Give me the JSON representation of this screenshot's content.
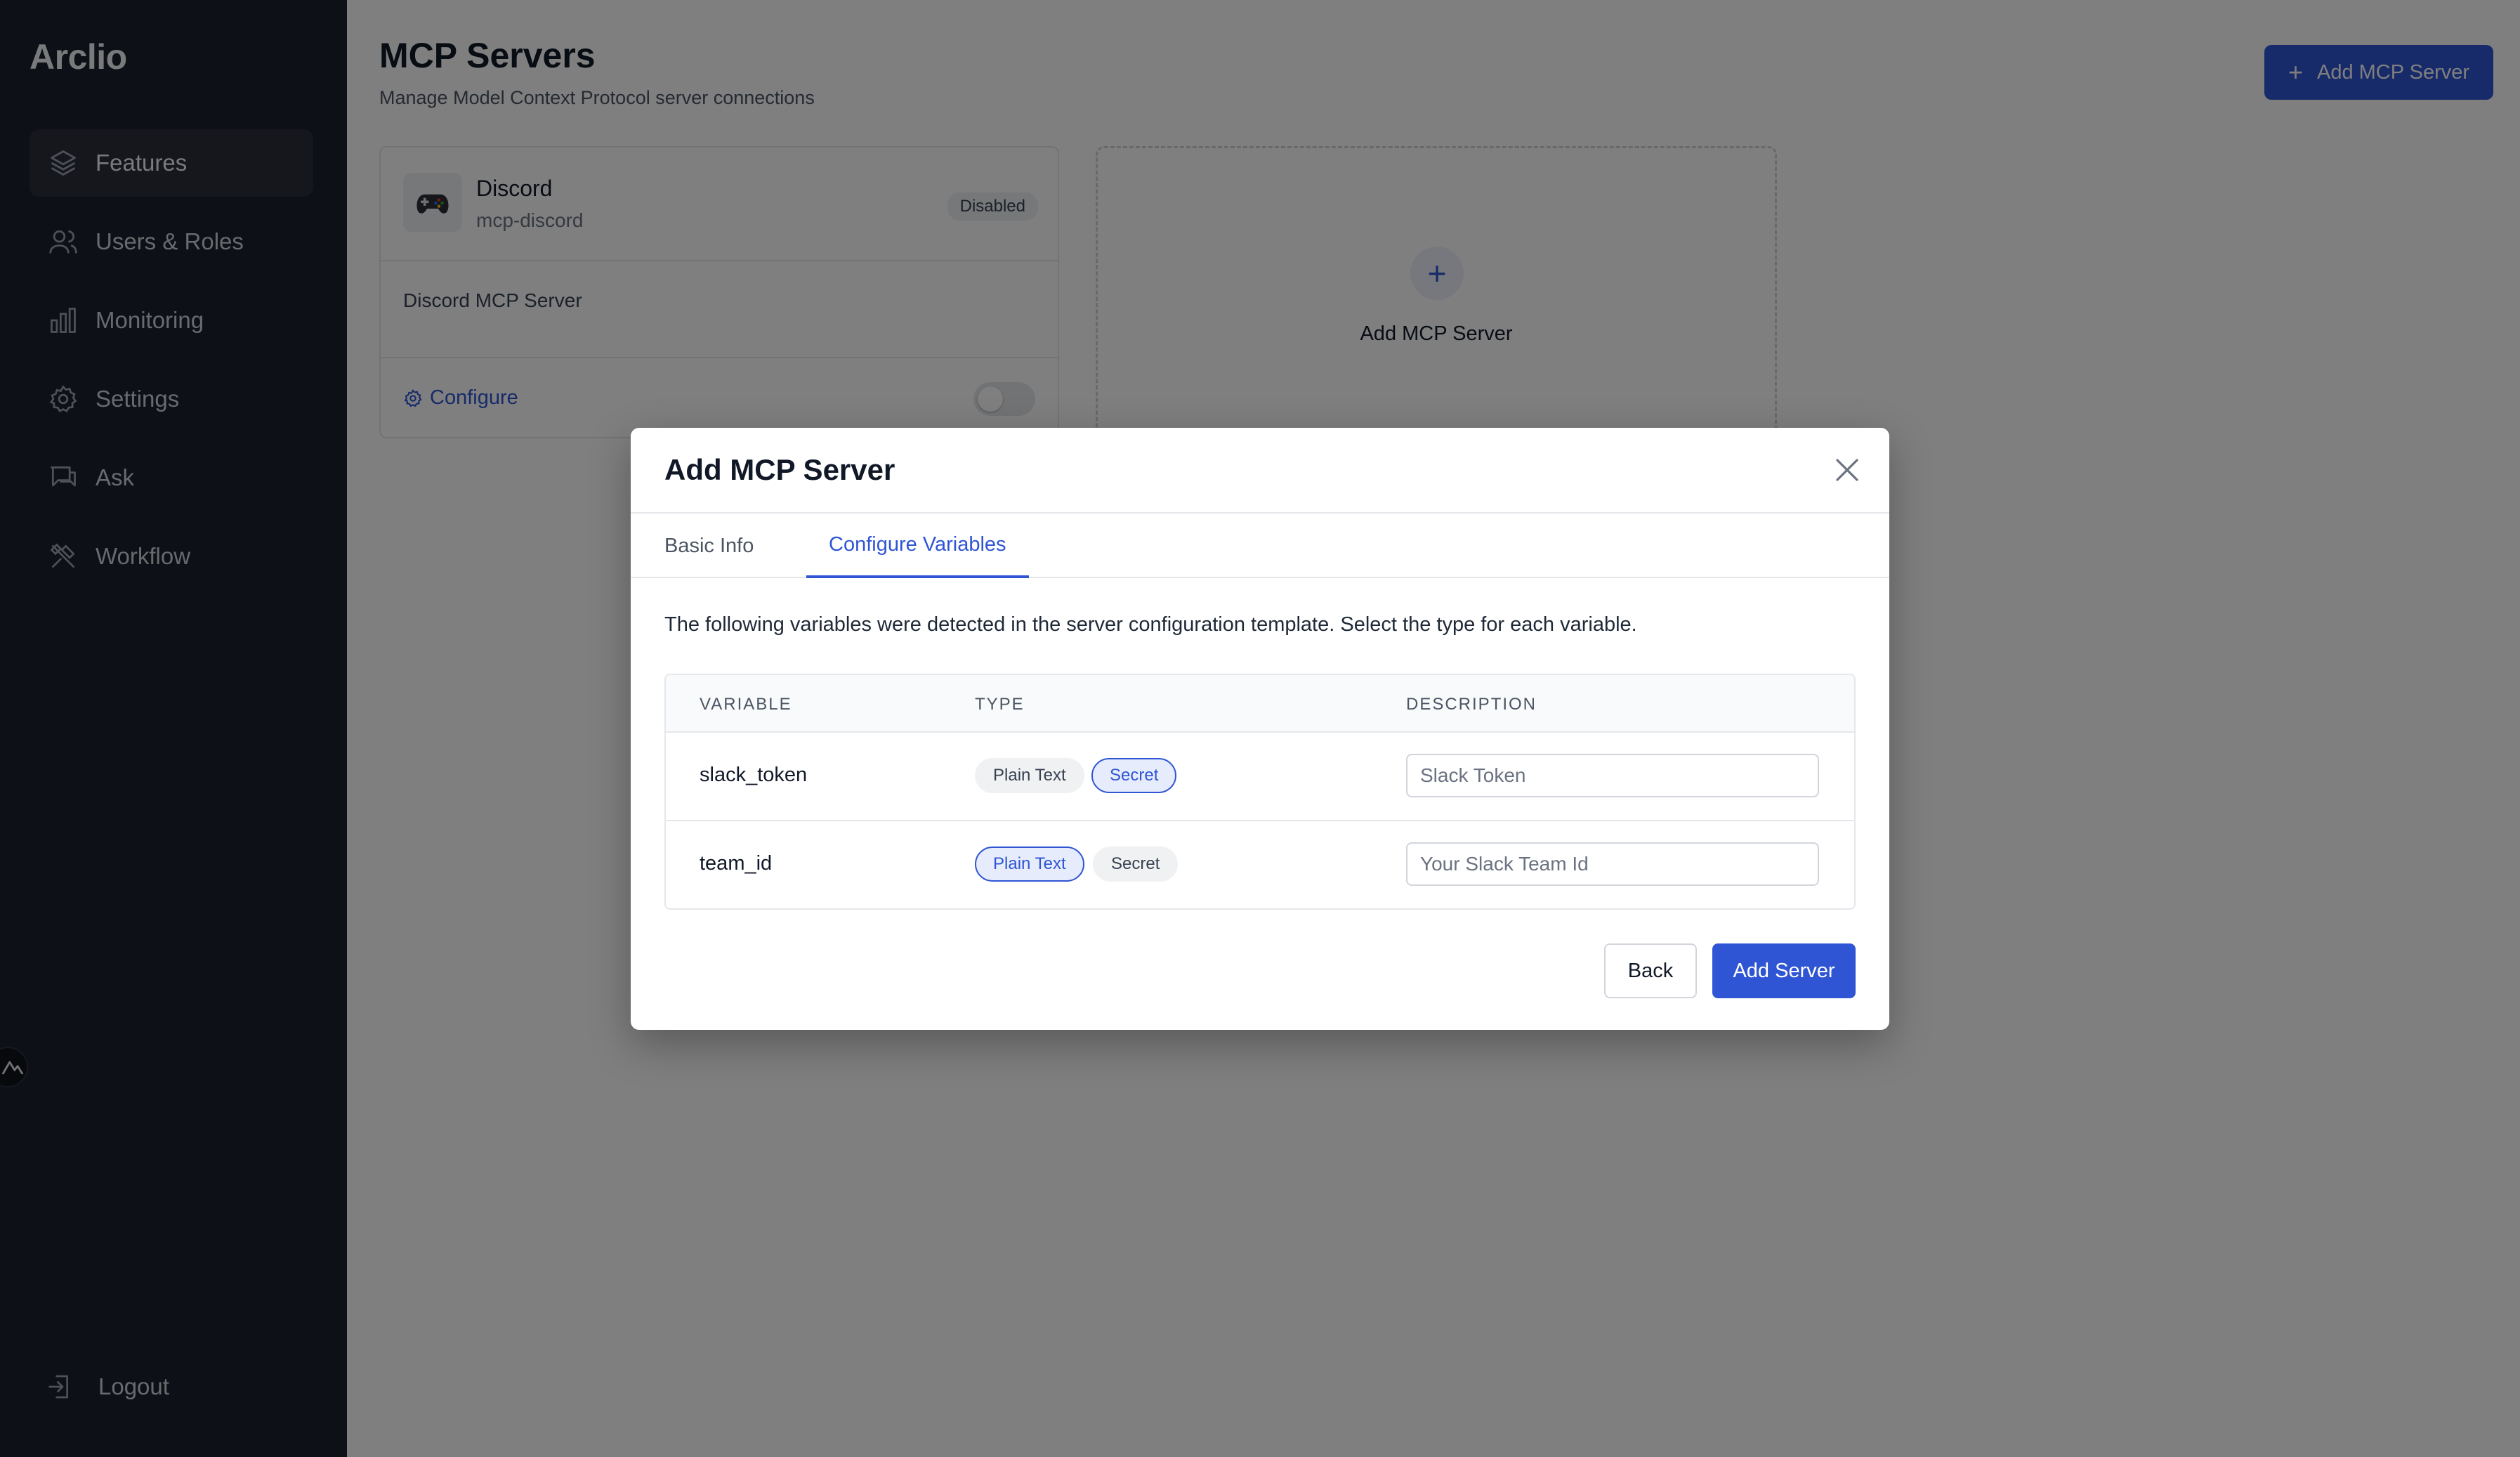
{
  "app": {
    "brand": "Arclio"
  },
  "sidebar": {
    "items": [
      {
        "label": "Features",
        "icon": "layers-icon",
        "active": true
      },
      {
        "label": "Users & Roles",
        "icon": "users-icon"
      },
      {
        "label": "Monitoring",
        "icon": "bar-chart-icon"
      },
      {
        "label": "Settings",
        "icon": "gear-icon"
      },
      {
        "label": "Ask",
        "icon": "chat-icon"
      },
      {
        "label": "Workflow",
        "icon": "tools-icon"
      }
    ],
    "logout": "Logout"
  },
  "page": {
    "title": "MCP Servers",
    "subtitle": "Manage Model Context Protocol server connections",
    "add_button": "Add MCP Server"
  },
  "servers": [
    {
      "name": "Discord",
      "slug": "mcp-discord",
      "status": "Disabled",
      "description": "Discord MCP Server",
      "configure_label": "Configure",
      "enabled": false
    }
  ],
  "add_card": {
    "label": "Add MCP Server"
  },
  "modal": {
    "title": "Add MCP Server",
    "tabs": [
      "Basic Info",
      "Configure Variables"
    ],
    "active_tab": "Configure Variables",
    "description": "The following variables were detected in the server configuration template. Select the type for each variable.",
    "columns": [
      "VARIABLE",
      "TYPE",
      "DESCRIPTION"
    ],
    "type_options": [
      "Plain Text",
      "Secret"
    ],
    "variables": [
      {
        "name": "slack_token",
        "type": "Secret",
        "description_placeholder": "Slack Token"
      },
      {
        "name": "team_id",
        "type": "Plain Text",
        "description_placeholder": "Your Slack Team Id"
      }
    ],
    "back_label": "Back",
    "submit_label": "Add Server"
  },
  "colors": {
    "accent": "#2f55d4",
    "sidebar_bg": "#1b202c"
  }
}
